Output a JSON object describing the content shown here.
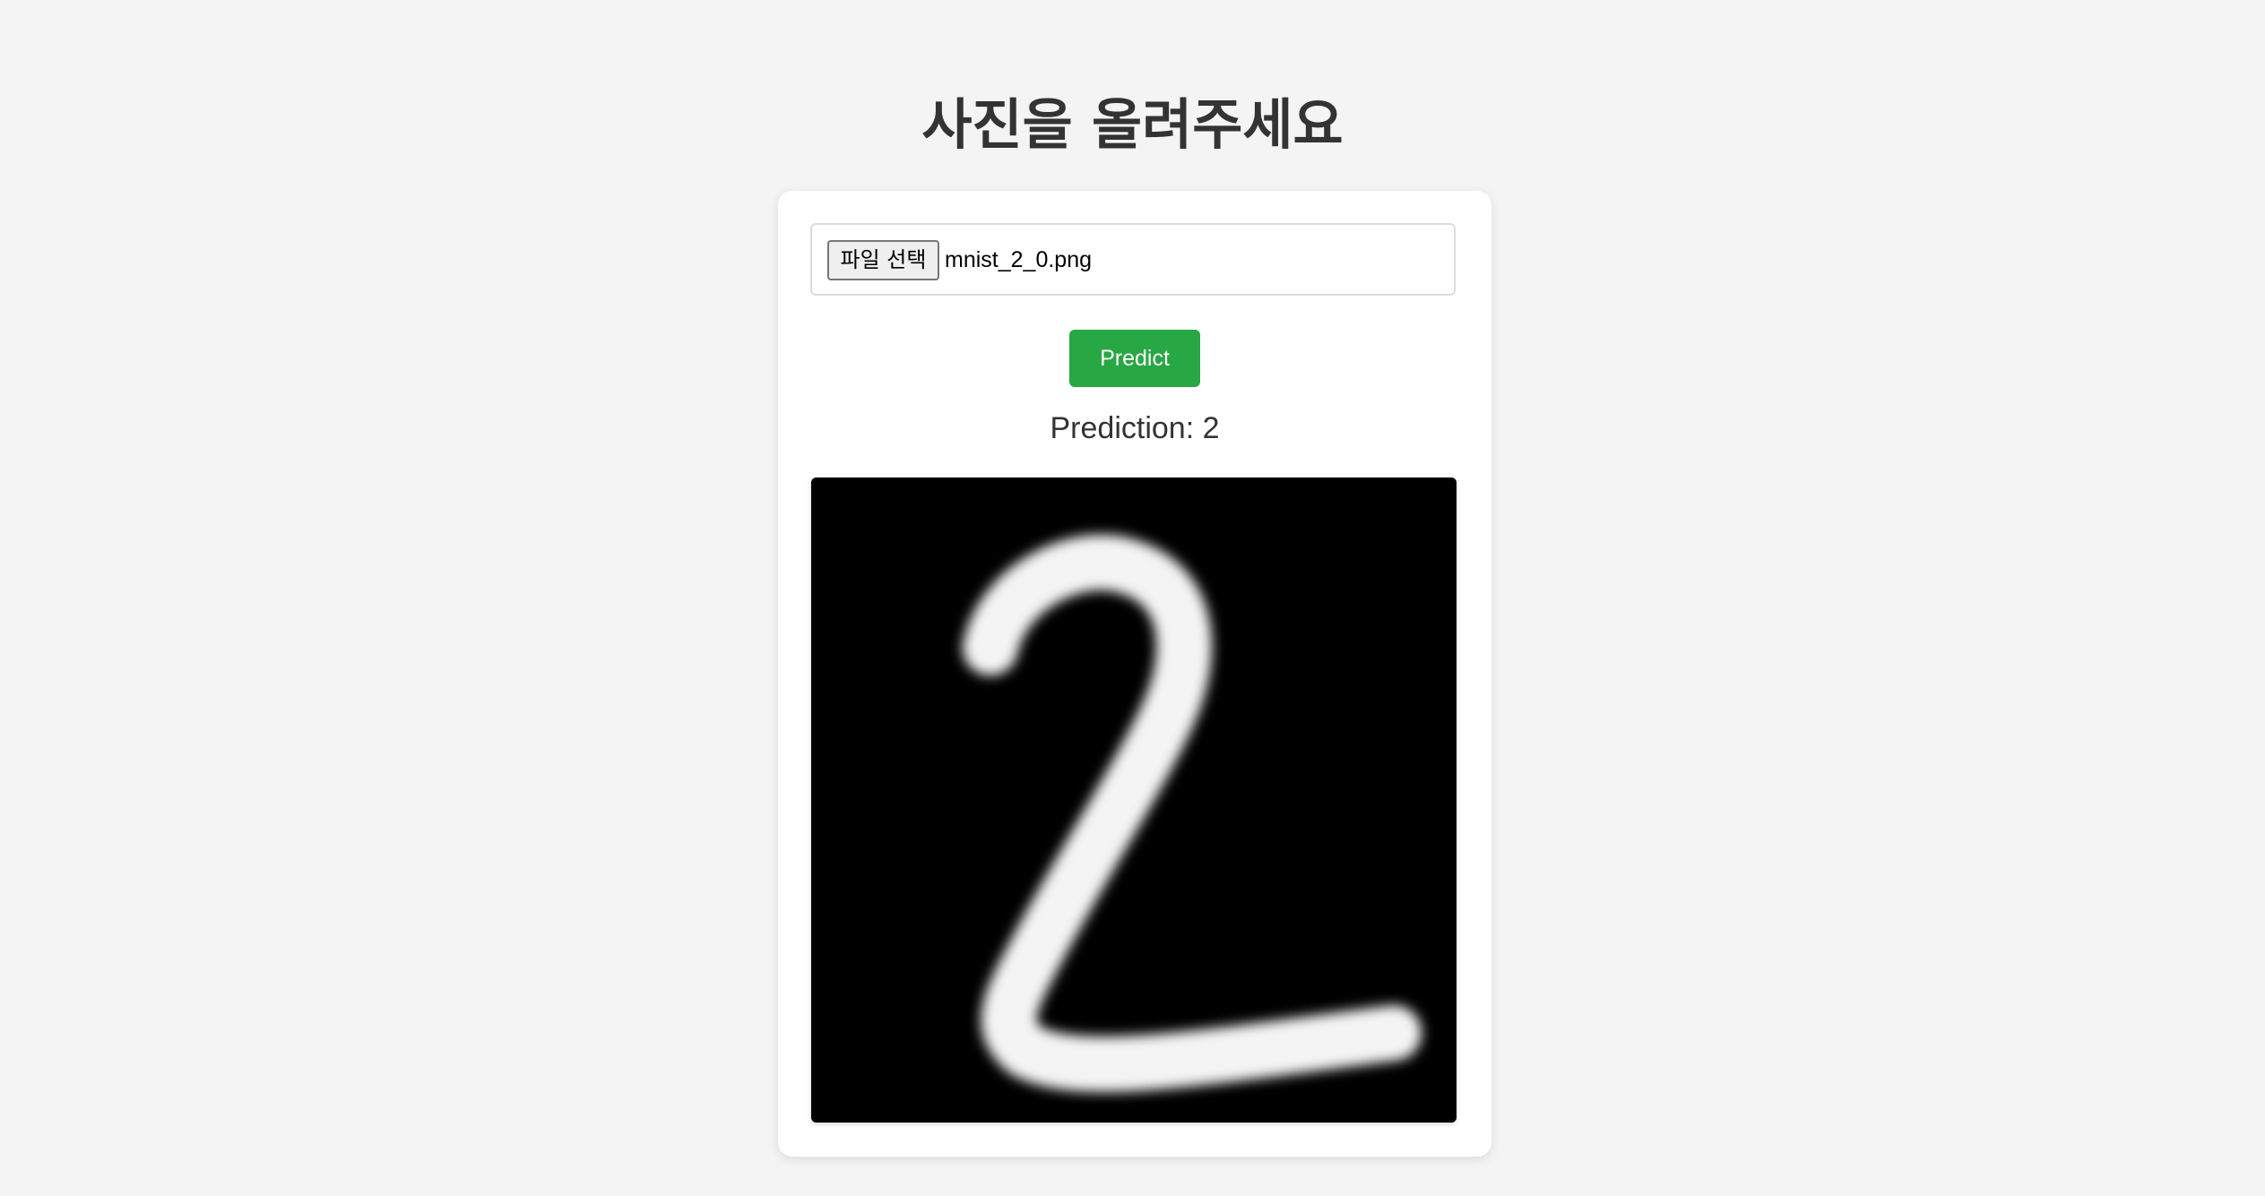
{
  "header": {
    "title": "사진을 올려주세요"
  },
  "upload": {
    "file_button_label": "파일 선택",
    "file_name": "mnist_2_0.png"
  },
  "actions": {
    "predict_label": "Predict"
  },
  "result": {
    "prediction_text": "Prediction: 2"
  },
  "colors": {
    "background": "#f4f4f4",
    "card": "#ffffff",
    "predict_button": "#28a745",
    "image_background": "#000000"
  }
}
